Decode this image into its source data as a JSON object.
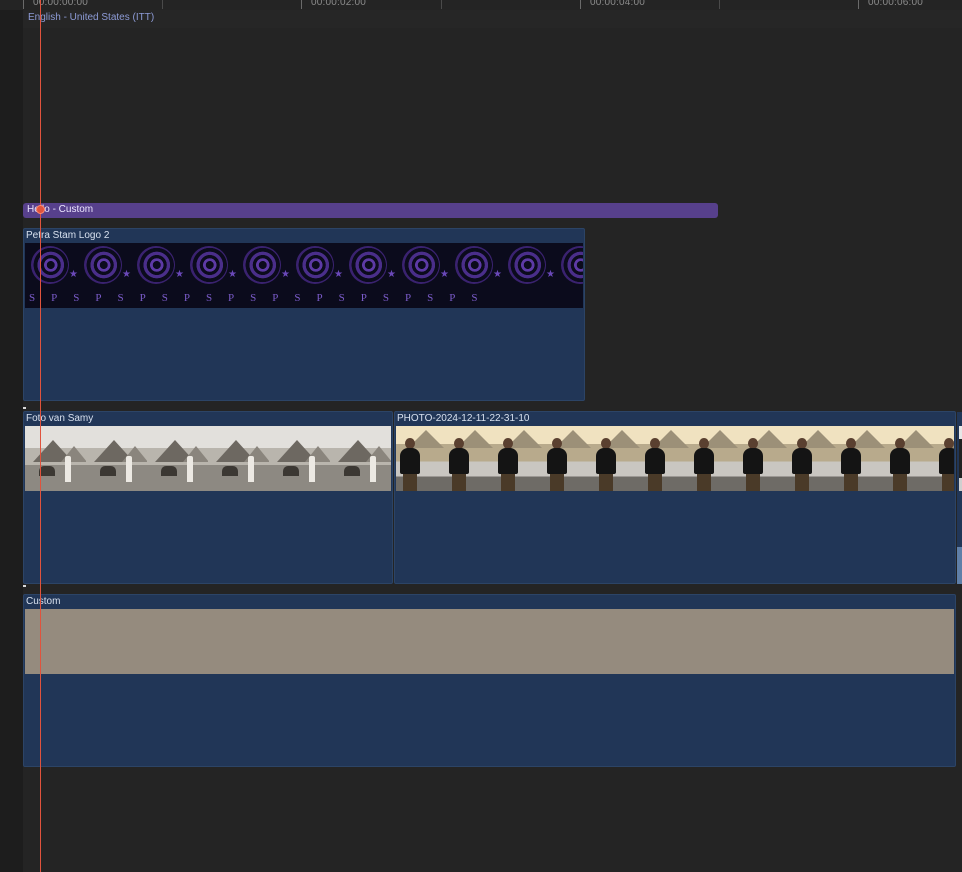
{
  "timeline": {
    "ruler": {
      "timecodes": [
        "00:00:00:00",
        "00:00:02:00",
        "00:00:04:00",
        "00:00:06:00"
      ]
    },
    "captions": {
      "label": "English - United States (ITT)"
    },
    "title_clip": {
      "label": "Hello - Custom"
    },
    "clips": {
      "logo": {
        "label": "Petra Stam Logo 2",
        "glyphs": "SPSPSPSPSPSPSPSPSPSPS"
      },
      "foto": {
        "label": "Foto van Samy"
      },
      "photo": {
        "label": "PHOTO-2024-12-11-22-31-10"
      },
      "custom": {
        "label": "Custom"
      }
    },
    "colors": {
      "playhead": "#e0533d",
      "title_clip": "#57408c",
      "video_clip": "#213657",
      "caption_text": "#8d9bd6",
      "custom_generator": "#958b7e"
    }
  }
}
